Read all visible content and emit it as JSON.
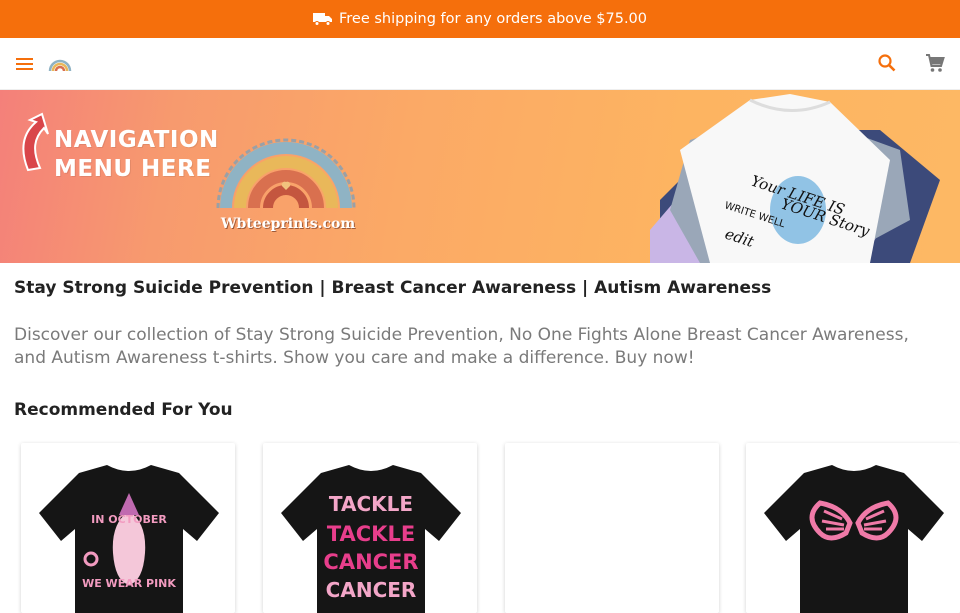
{
  "promo": {
    "text": "Free shipping for any orders above $75.00",
    "icon": "truck-icon"
  },
  "header": {
    "menu_icon": "menu-icon",
    "logo_icon": "rainbow-logo-icon",
    "search_icon": "search-icon",
    "cart_icon": "cart-icon"
  },
  "banner": {
    "nav_line1": "NAVIGATION",
    "nav_line2": "MENU HERE",
    "site": "Wbteeprints.com",
    "shirt_text_line1": "Your LIFE IS",
    "shirt_text_line2": "YOUR Story",
    "shirt_text_line3": "WRITE WELL",
    "shirt_text_line4": "edit"
  },
  "page": {
    "title": "Stay Strong Suicide Prevention | Breast Cancer Awareness | Autism Awareness",
    "description": "Discover our collection of Stay Strong Suicide Prevention, No One Fights Alone Breast Cancer Awareness, and Autism Awareness t-shirts. Show you care and make a difference. Buy now!"
  },
  "recommended": {
    "title": "Recommended For You",
    "products": [
      {
        "line1": "IN OCTOBER",
        "line2": "WE WEAR PINK"
      },
      {
        "line1": "TACKLE",
        "line2": "TACKLE",
        "line3": "CANCER",
        "line4": "CANCER"
      },
      {},
      {}
    ]
  },
  "colors": {
    "accent": "#f56f0c",
    "pink": "#e83e8c"
  }
}
